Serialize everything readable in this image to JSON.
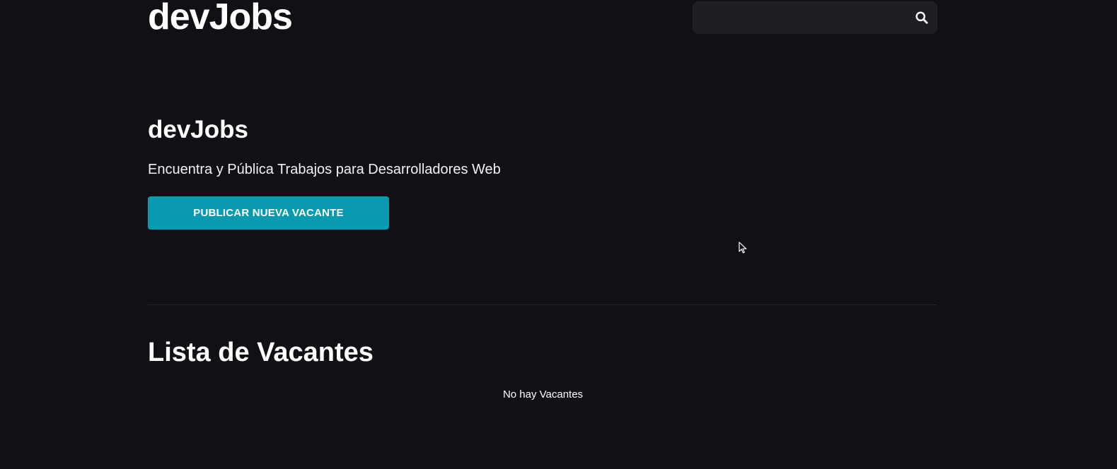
{
  "header": {
    "logo": "devJobs",
    "search": {
      "value": "",
      "placeholder": "",
      "icon": "search-icon"
    }
  },
  "hero": {
    "title": "devJobs",
    "subtitle": "Encuentra y Pública Trabajos para Desarrolladores Web",
    "button_label": "PUBLICAR NUEVA VACANTE"
  },
  "vacancies": {
    "title": "Lista de Vacantes",
    "empty_message": "No hay Vacantes"
  },
  "colors": {
    "background": "#121015",
    "accent": "#089bb0",
    "search_background": "#1f1e24"
  }
}
